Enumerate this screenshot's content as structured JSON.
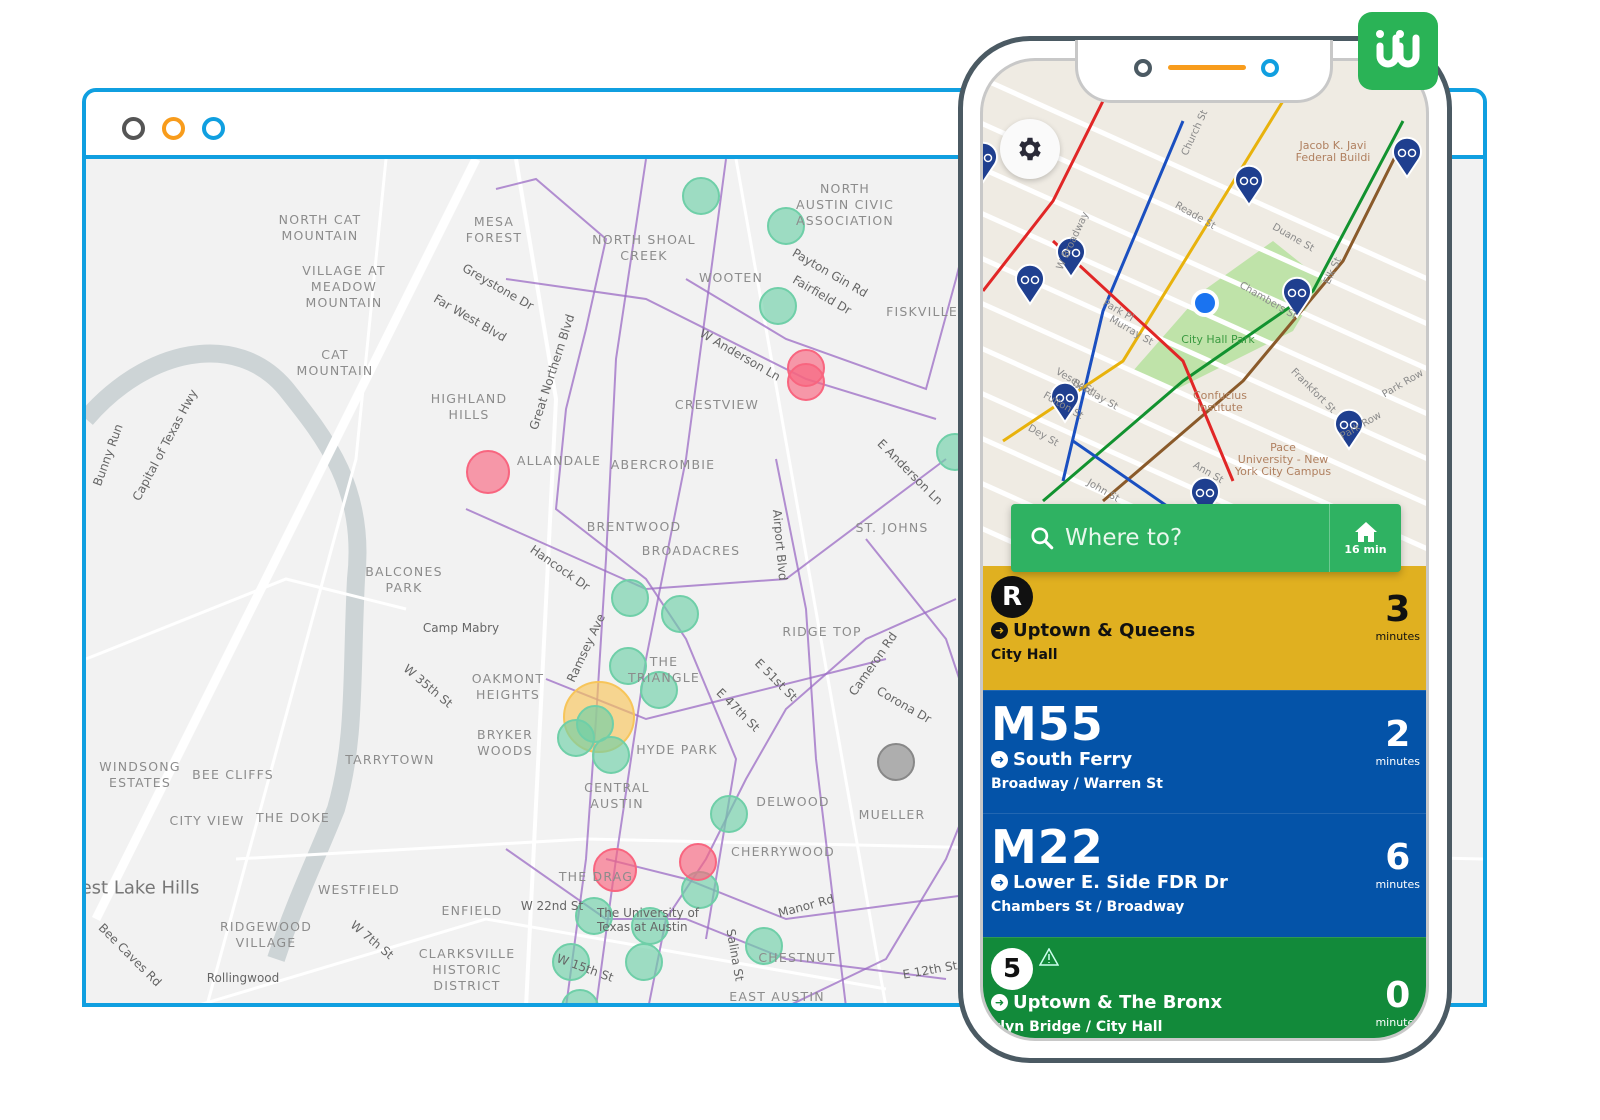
{
  "colors": {
    "frame": "#109fe0",
    "dot_gray": "#555555",
    "dot_orange": "#f89c1c",
    "dot_blue": "#109fe0",
    "marker_green": "#6fcfa8",
    "marker_red": "#f8657f",
    "marker_yellow": "#f7c55a",
    "marker_gray": "#888888",
    "transit_line": "#9b6bc4",
    "app_green": "#2fb262",
    "card_yellow": "#e0b020",
    "card_blue": "#0453a8",
    "card_green": "#128a3a"
  },
  "map": {
    "neighborhoods": [
      "NORTH CAT\nMOUNTAIN",
      "MESA\nFOREST",
      "NORTH SHOAL\nCREEK",
      "NORTH\nAUSTIN CIVIC\nASSOCIATION",
      "VILLAGE AT\nMEADOW\nMOUNTAIN",
      "WOOTEN",
      "FISKVILLE",
      "CAT\nMOUNTAIN",
      "CRESTVIEW",
      "HIGHLAND\nHILLS",
      "ALLANDALE",
      "ABERCROMBIE",
      "BRENTWOOD",
      "BROADACRES",
      "ST. JOHNS",
      "BALCONES\nPARK",
      "RIDGE TOP",
      "OAKMONT\nHEIGHTS",
      "THE\nTRIANGLE",
      "BRYKER\nWOODS",
      "HYDE PARK",
      "TARRYTOWN",
      "WINDSONG\nESTATES",
      "BEE CLIFFS",
      "CENTRAL\nAUSTIN",
      "DELWOOD",
      "MUELLER",
      "CITY VIEW",
      "THE DOKE",
      "CHERRYWOOD",
      "WESTFIELD",
      "THE DRAG",
      "ENFIELD",
      "RIDGEWOOD\nVILLAGE",
      "CLARKSVILLE\nHISTORIC\nDISTRICT",
      "CHESTNUT",
      "EAST AUSTIN"
    ],
    "streets": [
      "Greystone Dr",
      "Far West Blvd",
      "Payton Gin Rd",
      "Fairfield Dr",
      "W Anderson Ln",
      "Great Northern Blvd",
      "E Anderson Ln",
      "Hancock Dr",
      "Camp Mabry",
      "Ramsey Ave",
      "W 35th St",
      "E 51st St",
      "Cameron Rd",
      "Corona Dr",
      "E 47th St",
      "W 22nd St",
      "The University of\nTexas at Austin",
      "Manor Rd",
      "W 7th St",
      "Bee Caves Rd",
      "Salina St",
      "W 15th St",
      "E 12th St",
      "Rollingwood",
      "Bunny Run",
      "Capital of Texas Hwy",
      "Airport Blvd"
    ],
    "places": [
      "est Lake Hills"
    ]
  },
  "phone": {
    "map_streets": [
      "Reade St",
      "Duane St",
      "Elk St",
      "Chambers St",
      "Murray St",
      "Park Pl",
      "Barclay St",
      "Vesey St",
      "Fulton St",
      "Dey St",
      "John St",
      "Ann St",
      "Park Row",
      "Frankfort St",
      "W Broadway",
      "Church St",
      "Park Row"
    ],
    "pois": [
      "City Hall Park",
      "Confucius\nInstitute",
      "Pace\nUniversity - New\nYork City Campus",
      "Jacob K. Javi\nFederal Buildi"
    ],
    "search": {
      "placeholder": "Where to?",
      "home_time": "16 min"
    },
    "departures": [
      {
        "route": "R",
        "direction": "Uptown & Queens",
        "stop": "City Hall",
        "minutes": "3",
        "unit": "minutes",
        "color": "#e0b020"
      },
      {
        "route": "M55",
        "direction": "South Ferry",
        "stop": "Broadway / Warren St",
        "minutes": "2",
        "unit": "minutes",
        "color": "#0453a8"
      },
      {
        "route": "M22",
        "direction": "Lower E. Side FDR Dr",
        "stop": "Chambers St / Broadway",
        "minutes": "6",
        "unit": "minutes",
        "color": "#0453a8"
      },
      {
        "route": "5",
        "direction": "Uptown & The Bronx",
        "stop": "klyn Bridge / City Hall",
        "minutes": "0",
        "unit": "minutes",
        "color": "#128a3a",
        "alert": "warning-icon"
      }
    ]
  }
}
